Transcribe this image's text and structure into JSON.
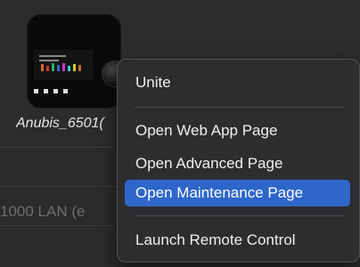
{
  "device": {
    "name_label": "Anubis_6501("
  },
  "background": {
    "row_text": "1000 LAN  (e"
  },
  "context_menu": {
    "items": [
      {
        "label": "Unite"
      },
      {
        "label": "Open Web App Page"
      },
      {
        "label": "Open Advanced Page"
      },
      {
        "label": "Open Maintenance Page",
        "highlighted": true
      },
      {
        "label": "Launch Remote Control"
      }
    ],
    "highlight_color": "#2e66c9"
  }
}
